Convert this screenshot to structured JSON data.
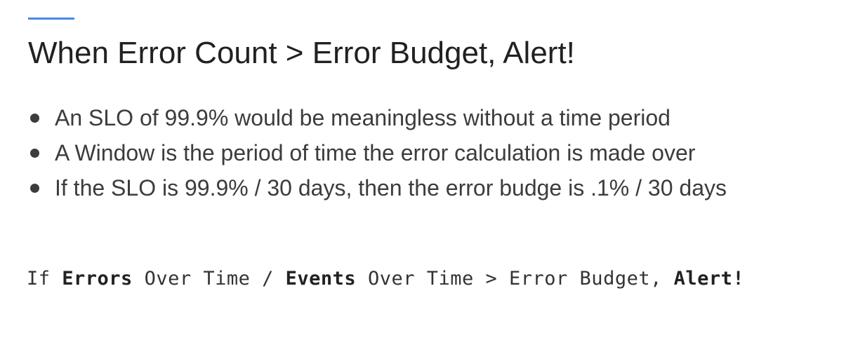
{
  "slide": {
    "title": "When Error Count > Error Budget, Alert!",
    "accent_color": "#4a86e8",
    "bullets": [
      "An SLO of 99.9% would be meaningless without a time period",
      "A Window is the period of time the error calculation is made over",
      "If the SLO is 99.9% / 30 days, then the error budge is .1% / 30 days"
    ],
    "formula": {
      "p1": "If ",
      "p2": "Errors",
      "p3": " Over Time / ",
      "p4": "Events",
      "p5": " Over Time > Error Budget, ",
      "p6": "Alert!"
    }
  }
}
